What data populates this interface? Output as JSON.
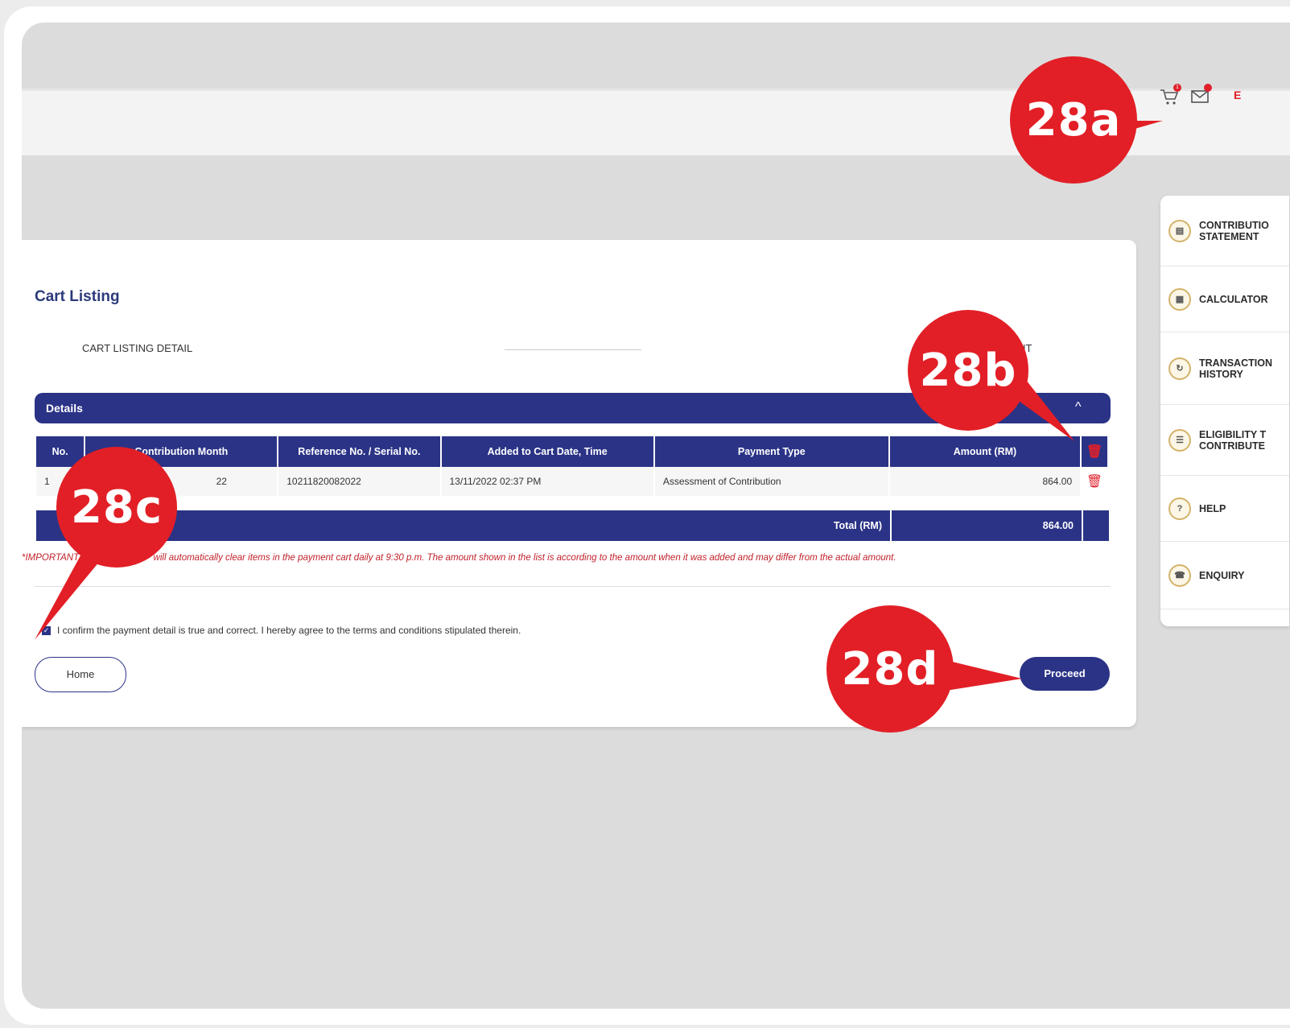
{
  "header": {
    "cart_badge": "1",
    "top_right_partial": "E"
  },
  "cart": {
    "title": "Cart Listing",
    "step_left": "CART LISTING DETAIL",
    "step_right": "YMENT",
    "details_label": "Details",
    "columns": [
      "No.",
      "Contribution Month",
      "Reference No. / Serial No.",
      "Added to Cart Date, Time",
      "Payment Type",
      "Amount (RM)"
    ],
    "rows": [
      {
        "no": "1",
        "month": "22",
        "reference": "10211820082022",
        "added": "13/11/2022 02:37 PM",
        "type": "Assessment of Contribution",
        "amount": "864.00"
      }
    ],
    "total_label": "Total (RM)",
    "total_value": "864.00",
    "note_start": "*IMPORTANT",
    "note_rest": "will automatically clear items in the payment cart daily at 9:30 p.m. The amount shown in the list is according to the amount when it was added and may differ from the actual amount.",
    "confirm_text": "I confirm the payment detail is true and correct. I hereby agree to the terms and conditions stipulated therein.",
    "home_label": "Home",
    "proceed_label": "Proceed"
  },
  "sidebar": {
    "items": [
      {
        "line1": "CONTRIBUTIO",
        "line2": "STATEMENT"
      },
      {
        "line1": "CALCULATOR",
        "line2": ""
      },
      {
        "line1": "TRANSACTION",
        "line2": "HISTORY"
      },
      {
        "line1": "ELIGIBILITY T",
        "line2": "CONTRIBUTE"
      },
      {
        "line1": "HELP",
        "line2": ""
      },
      {
        "line1": "ENQUIRY",
        "line2": ""
      }
    ]
  },
  "annotations": {
    "a": "28a",
    "b": "28b",
    "c": "28c",
    "d": "28d",
    "color": "#e21f26"
  }
}
